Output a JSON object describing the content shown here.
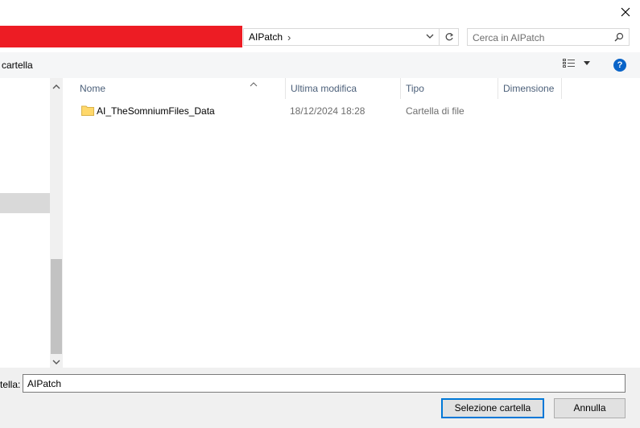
{
  "window": {
    "close_icon": "close-icon",
    "banner_color": "#ed1c24"
  },
  "address_bar": {
    "breadcrumb": "AIPatch",
    "separator": "›",
    "dropdown_icon": "chevron-down-icon",
    "refresh_icon": "refresh-icon"
  },
  "search": {
    "placeholder": "Cerca in AIPatch",
    "icon": "search-icon"
  },
  "toolbar": {
    "new_folder_label": "cartella",
    "view_icon": "view-options-icon",
    "help_label": "?"
  },
  "columns": {
    "name": "Nome",
    "modified": "Ultima modifica",
    "type": "Tipo",
    "size": "Dimensione"
  },
  "files": [
    {
      "name": "AI_TheSomniumFiles_Data",
      "modified": "18/12/2024 18:28",
      "type": "Cartella di file",
      "size": "",
      "icon": "folder-icon"
    }
  ],
  "footer": {
    "folder_label": "tella:",
    "folder_value": "AIPatch",
    "select_button": "Selezione cartella",
    "cancel_button": "Annulla"
  },
  "colors": {
    "accent": "#0078d7",
    "header_text": "#4c607a",
    "help_blue": "#0a64c8"
  }
}
